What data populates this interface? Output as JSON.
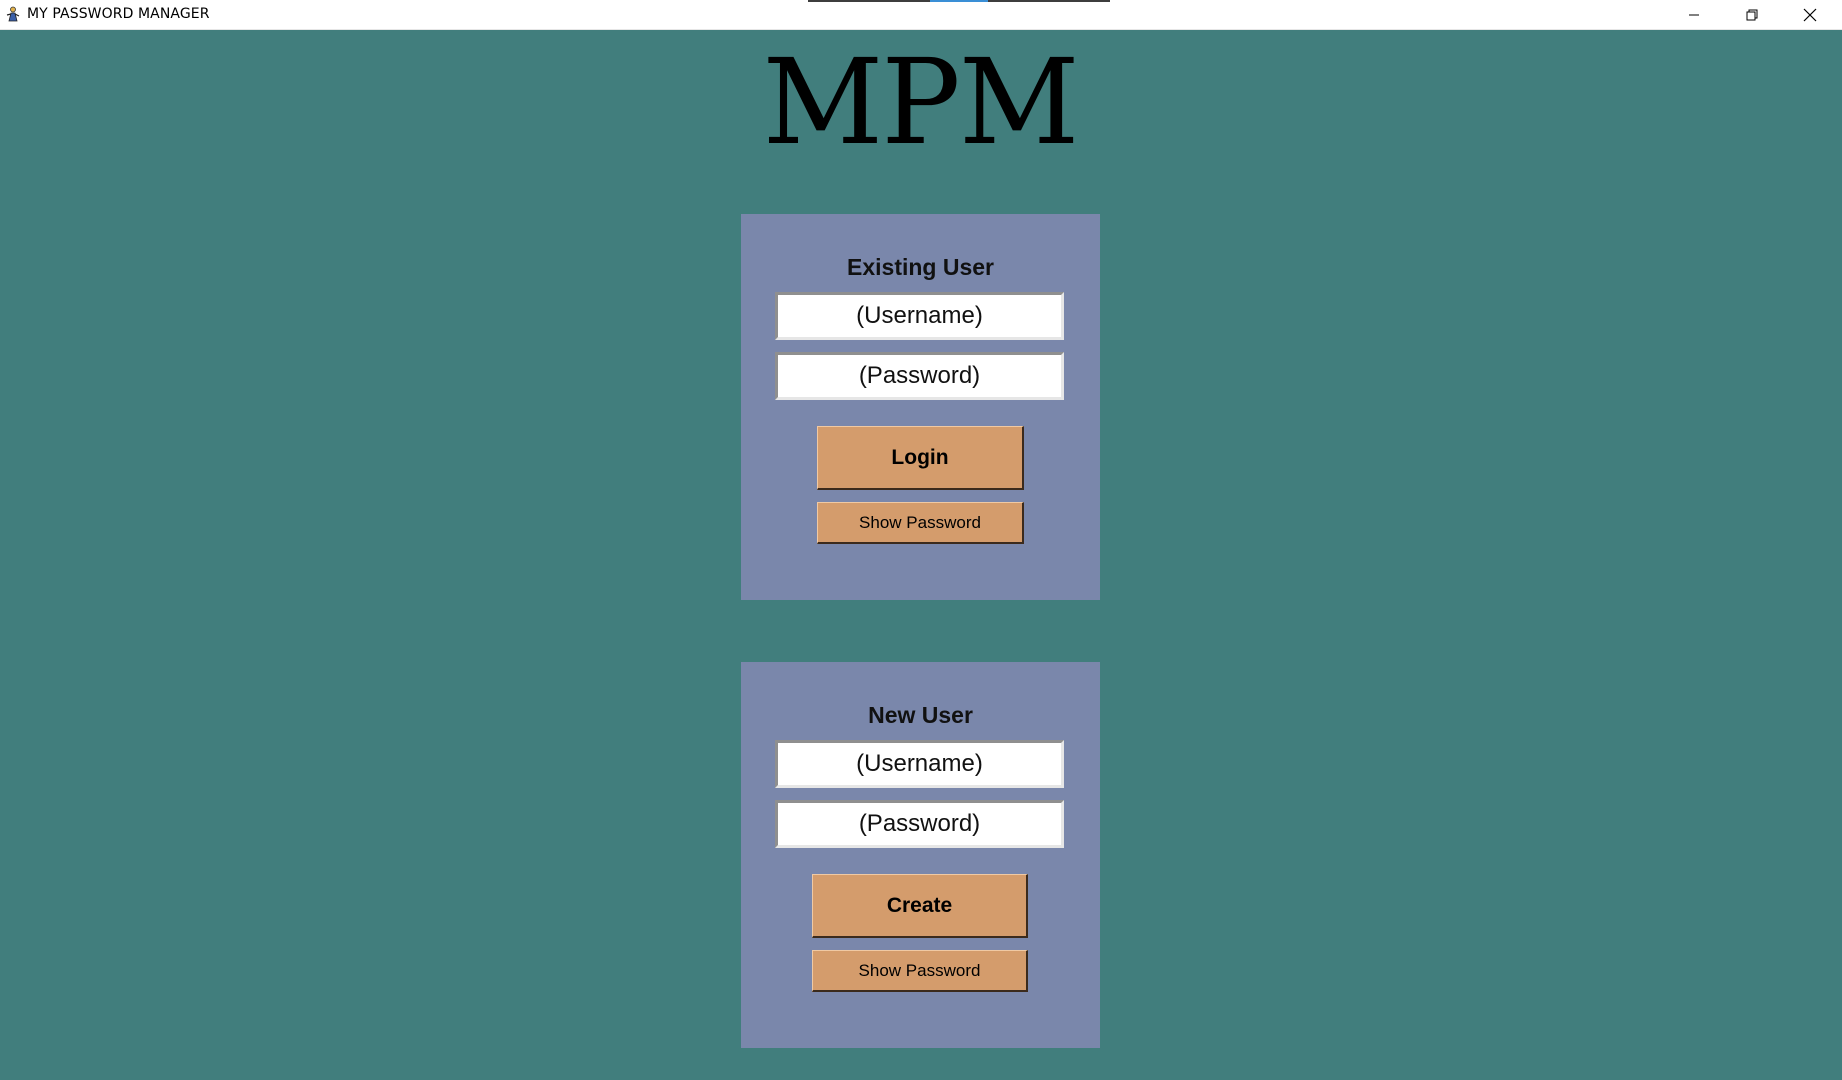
{
  "window": {
    "title": "MY PASSWORD MANAGER",
    "background_color": "#417e7d",
    "controls": {
      "minimize_icon": "minimize-icon",
      "maximize_icon": "restore-icon",
      "close_icon": "close-icon"
    }
  },
  "logo": {
    "text": "MPM"
  },
  "existing_user": {
    "heading": "Existing User",
    "username_value": "(Username)",
    "password_value": "(Password)",
    "login_label": "Login",
    "show_password_label": "Show Password"
  },
  "new_user": {
    "heading": "New User",
    "username_value": "(Username)",
    "password_value": "(Password)",
    "create_label": "Create",
    "show_password_label": "Show Password"
  },
  "colors": {
    "panel": "#7a87ab",
    "button": "#d49c6c",
    "field": "#ffffff"
  }
}
